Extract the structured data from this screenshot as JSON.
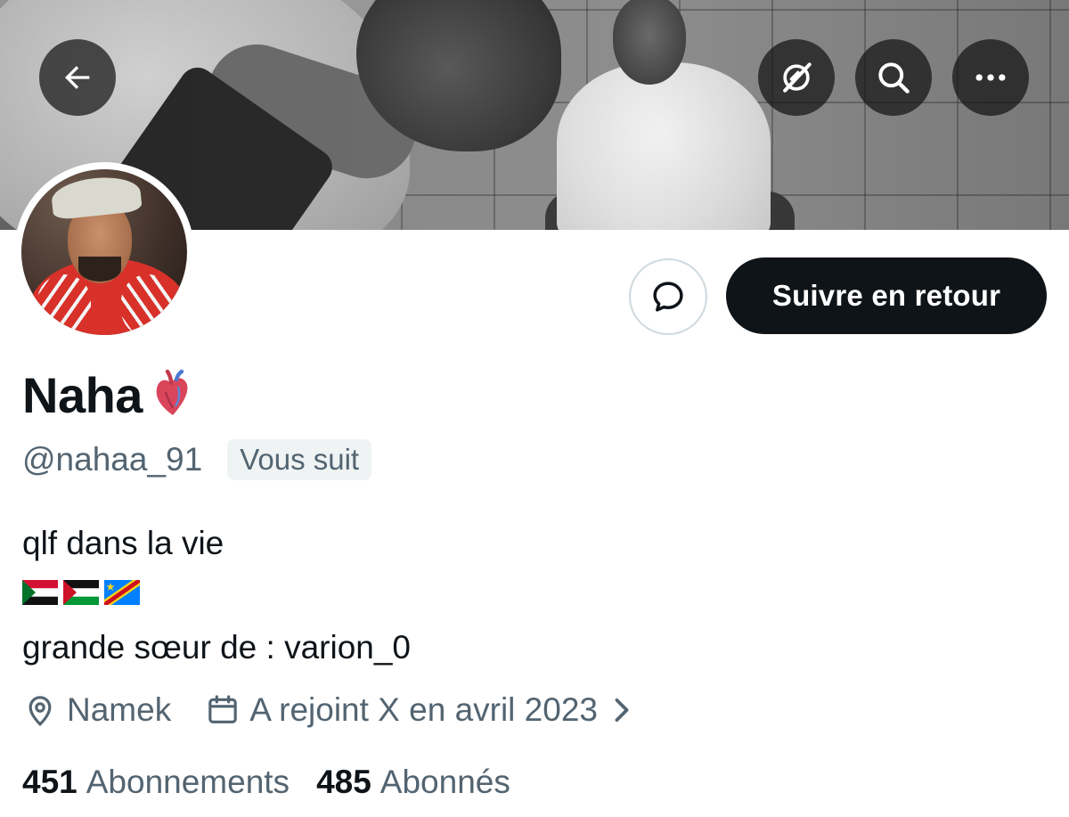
{
  "header": {
    "back_icon": "arrow-left-icon",
    "grok_icon": "grok-icon",
    "search_icon": "search-icon",
    "more_icon": "more-horizontal-icon"
  },
  "profile": {
    "display_name": "Naha",
    "name_emoji": "anatomical-heart-icon",
    "handle": "@nahaa_91",
    "follows_you_label": "Vous suit",
    "bio_line_1": "qlf dans la vie",
    "bio_flags": [
      "Sudan",
      "Palestine",
      "DR Congo"
    ],
    "bio_line_2": "grande sœur de : varion_0",
    "location": "Namek",
    "joined": "A rejoint X en avril 2023",
    "following_count": "451",
    "following_label": "Abonnements",
    "followers_count": "485",
    "followers_label": "Abonnés"
  },
  "actions": {
    "message_icon": "message-bubble-icon",
    "follow_back_label": "Suivre en retour"
  },
  "colors": {
    "text_primary": "#0f1419",
    "text_secondary": "#536471",
    "button_dark": "#0f1419",
    "badge_bg": "#eff3f4",
    "border": "#cfd9de"
  }
}
